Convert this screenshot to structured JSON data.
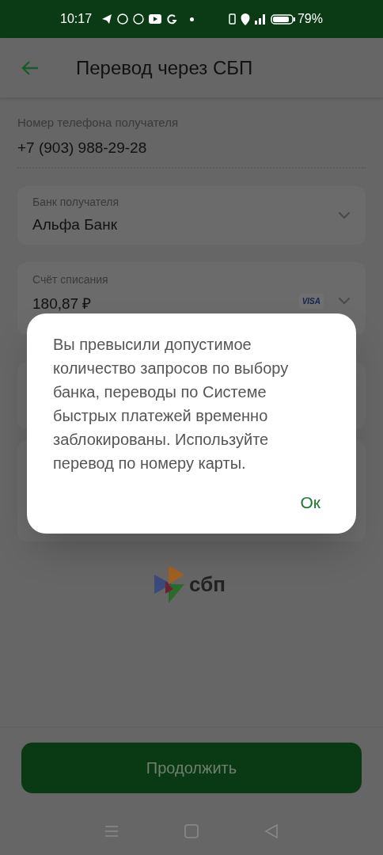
{
  "status_bar": {
    "time": "10:17",
    "battery": "79%"
  },
  "header": {
    "title": "Перевод через СБП"
  },
  "phone": {
    "label": "Номер телефона получателя",
    "value": "+7 (903) 988-29-28"
  },
  "bank": {
    "label": "Банк получателя",
    "value": "Альфа Банк"
  },
  "account": {
    "label": "Счёт списания",
    "value": "180,87 ₽",
    "card_brand": "VISA"
  },
  "logo": {
    "text": "сбп"
  },
  "continue_button": {
    "label": "Продолжить",
    "disabled": true
  },
  "dialog": {
    "message": "Вы превысили допустимое количество запросов по выбору банка, переводы по Системе быстрых платежей временно заблокированы. Используйте перевод по номеру карты.",
    "button": "Ок"
  }
}
